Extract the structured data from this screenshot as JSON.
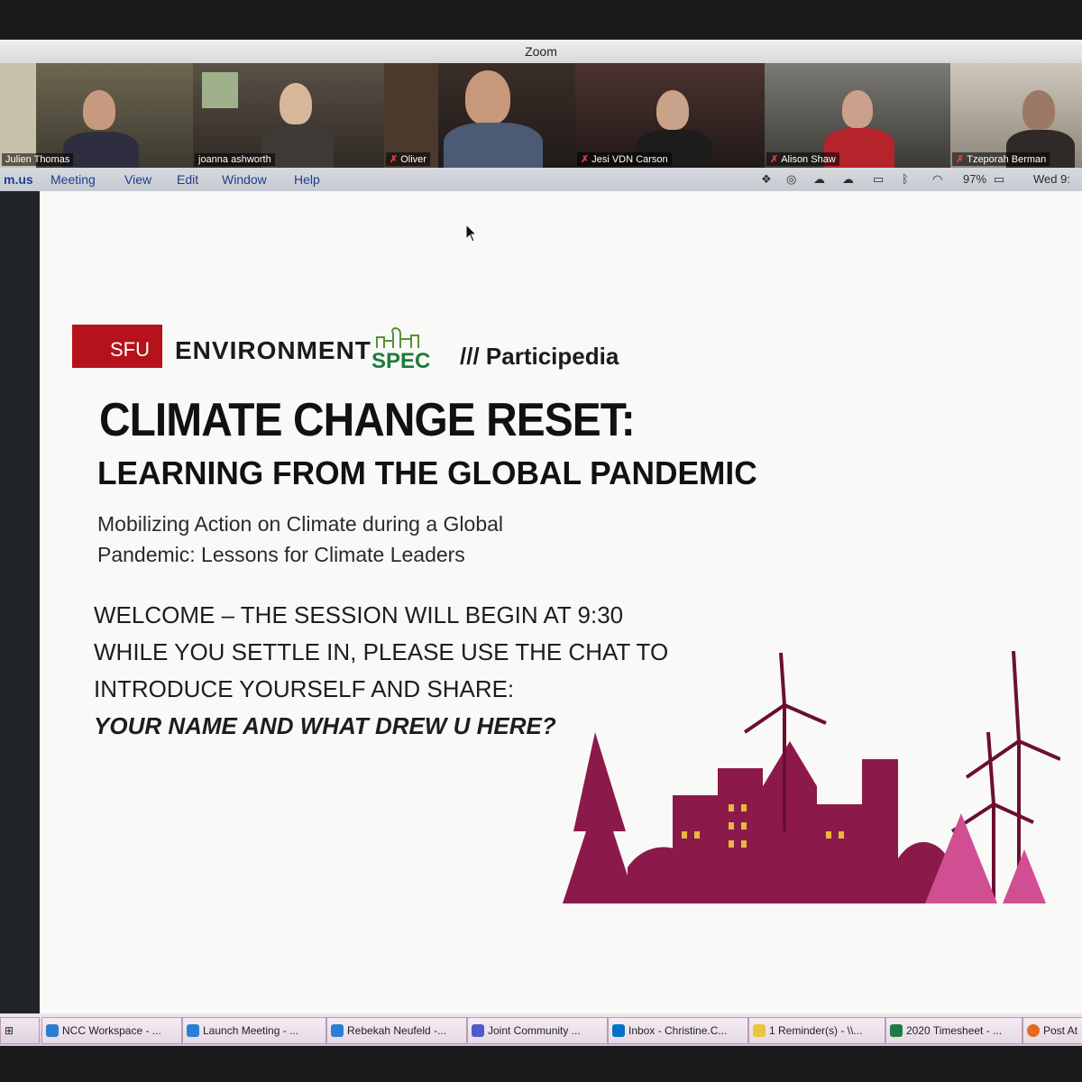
{
  "window": {
    "title": "Zoom"
  },
  "participants": [
    {
      "name": "Julien Thomas",
      "muted": false
    },
    {
      "name": "joanna ashworth",
      "muted": false
    },
    {
      "name": "Oliver",
      "muted": true
    },
    {
      "name": "Jesi VDN Carson",
      "muted": true
    },
    {
      "name": "Alison Shaw",
      "muted": true
    },
    {
      "name": "Tzeporah Berman",
      "muted": true
    }
  ],
  "menubar": {
    "app": "m.us",
    "items": [
      "Meeting",
      "View",
      "Edit",
      "Window",
      "Help"
    ],
    "battery": "97%",
    "clock": "Wed 9:"
  },
  "slide": {
    "sfu": "SFU",
    "environment": "ENVIRONMENT",
    "spec": "SPEC",
    "participedia": "/// Participedia",
    "title_line1": "CLIMATE CHANGE RESET:",
    "title_line2": "LEARNING FROM THE GLOBAL PANDEMIC",
    "subtitle_line1": "Mobilizing Action on Climate during a Global",
    "subtitle_line2": "Pandemic: Lessons for Climate Leaders",
    "welcome_line1": "WELCOME – THE SESSION WILL BEGIN AT 9:30",
    "welcome_line2": "WHILE YOU SETTLE IN, PLEASE USE THE CHAT TO",
    "welcome_line3": "INTRODUCE YOURSELF AND SHARE:",
    "welcome_line4": "YOUR NAME AND WHAT DREW U HERE?"
  },
  "taskbar": [
    {
      "label": "NCC Workspace - ...",
      "icon": "ie-icon"
    },
    {
      "label": "Launch Meeting - ...",
      "icon": "ie-icon"
    },
    {
      "label": "Rebekah Neufeld -...",
      "icon": "ie-icon"
    },
    {
      "label": "Joint Community ...",
      "icon": "teams-icon"
    },
    {
      "label": "Inbox - Christine.C...",
      "icon": "outlook-icon"
    },
    {
      "label": "1 Reminder(s) - \\\\...",
      "icon": "bell-icon"
    },
    {
      "label": "2020 Timesheet - ...",
      "icon": "excel-icon"
    },
    {
      "label": "Post At",
      "icon": "firefox-icon"
    }
  ],
  "colors": {
    "sfu_red": "#b5121b",
    "spec_green": "#1f7a3c",
    "illustration": "#8b1a4a"
  }
}
